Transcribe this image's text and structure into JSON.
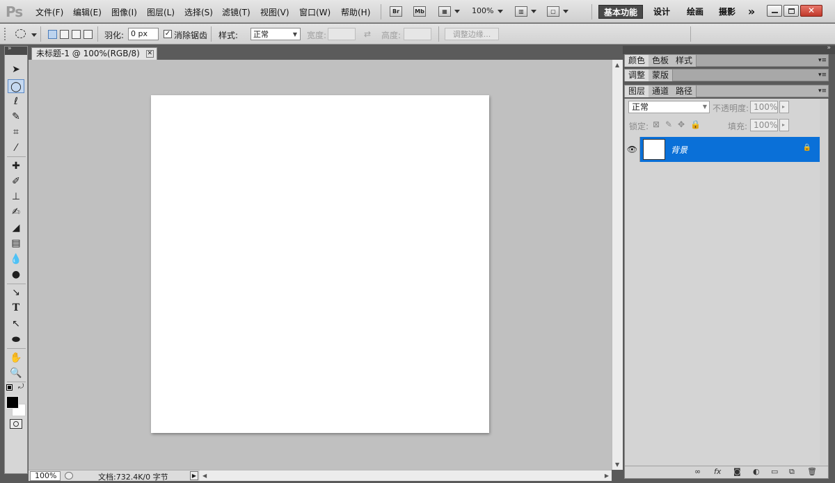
{
  "app": {
    "logo": "Ps"
  },
  "menu": {
    "items": [
      "文件(F)",
      "编辑(E)",
      "图像(I)",
      "图层(L)",
      "选择(S)",
      "滤镜(T)",
      "视图(V)",
      "窗口(W)",
      "帮助(H)"
    ],
    "bridge_label": "Br",
    "minibridge_label": "Mb",
    "zoom": "100%",
    "workspaces": [
      "基本功能",
      "设计",
      "绘画",
      "摄影"
    ],
    "more": "»"
  },
  "options": {
    "feather_label": "羽化:",
    "feather_value": "0 px",
    "antialias_label": "消除锯齿",
    "style_label": "样式:",
    "style_value": "正常",
    "width_label": "宽度:",
    "height_label": "高度:",
    "refine_edge_label": "调整边缘..."
  },
  "document": {
    "tab_title": "未标题-1 @ 100%(RGB/8)",
    "zoom": "100%",
    "info": "文档:732.4K/0 字节"
  },
  "panels": {
    "group1_tabs": [
      "颜色",
      "色板",
      "样式"
    ],
    "group2_tabs": [
      "调整",
      "蒙版"
    ],
    "group3_tabs": [
      "图层",
      "通道",
      "路径"
    ],
    "blend_mode": "正常",
    "opacity_label": "不透明度:",
    "opacity_value": "100%",
    "lock_label": "锁定:",
    "fill_label": "填充:",
    "fill_value": "100%",
    "layer_name": "背景"
  },
  "colors": {
    "selection": "#0a70d8",
    "canvas_bg": "#c0c0c0"
  }
}
